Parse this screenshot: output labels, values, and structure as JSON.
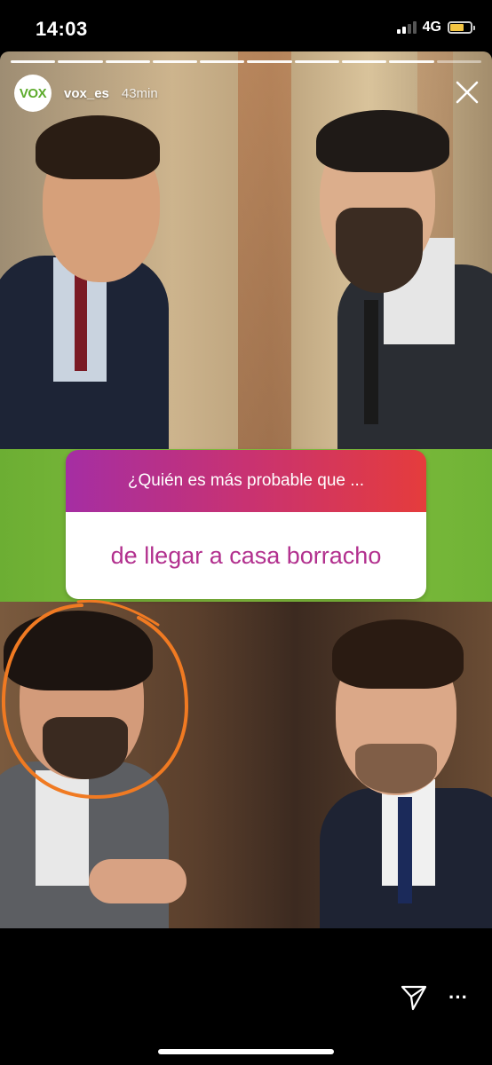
{
  "status_bar": {
    "time": "14:03",
    "network": "4G"
  },
  "story": {
    "progress_segments_total": 10,
    "progress_segments_viewed": 9,
    "account": {
      "avatar_text": "VOX",
      "username": "vox_es",
      "time_ago": "43min"
    },
    "question_sticker": {
      "prompt": "¿Quién es más probable que ...",
      "answer": "de llegar a casa borracho"
    }
  },
  "icons": {
    "close": "close-icon",
    "share": "send-icon",
    "more": "more-icon"
  },
  "colors": {
    "sticker_gradient_start": "#a52ea3",
    "sticker_gradient_end": "#e53c3c",
    "answer_text": "#b2308e",
    "highlight_ring": "#f07a22",
    "brand_green": "#5dab2c"
  }
}
